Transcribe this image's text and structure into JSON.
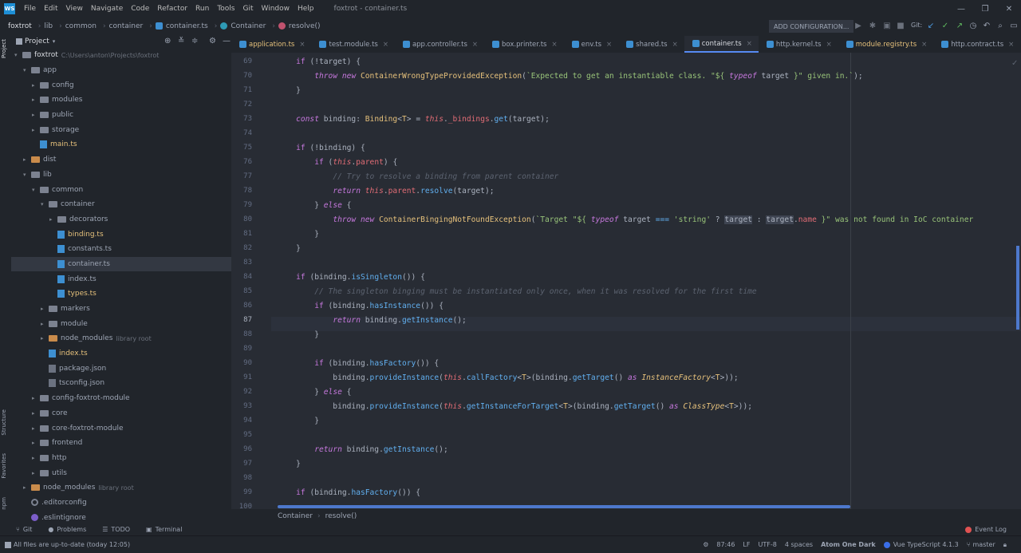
{
  "menu": [
    "File",
    "Edit",
    "View",
    "Navigate",
    "Code",
    "Refactor",
    "Run",
    "Tools",
    "Git",
    "Window",
    "Help"
  ],
  "window_title": "foxtrot - container.ts",
  "nav": {
    "crumbs": [
      "foxtrot",
      "lib",
      "common",
      "container",
      "container.ts",
      "Container",
      "resolve()"
    ],
    "run_config": "ADD CONFIGURATION...",
    "git_label": "Git:"
  },
  "sidebar": {
    "project_label": "Project",
    "structure_label": "Structure",
    "favorites_label": "Favorites",
    "npm_label": "npm"
  },
  "tree": [
    {
      "d": 0,
      "arrow": "▾",
      "icon": "folder",
      "label": "foxtrot",
      "extra": "C:\\Users\\anton\\Projects\\foxtrot"
    },
    {
      "d": 1,
      "arrow": "▾",
      "icon": "folder",
      "label": "app"
    },
    {
      "d": 2,
      "arrow": "▸",
      "icon": "folder",
      "label": "config"
    },
    {
      "d": 2,
      "arrow": "▸",
      "icon": "folder",
      "label": "modules"
    },
    {
      "d": 2,
      "arrow": "▸",
      "icon": "folder",
      "label": "public"
    },
    {
      "d": 2,
      "arrow": "▸",
      "icon": "folder",
      "label": "storage"
    },
    {
      "d": 2,
      "arrow": "",
      "icon": "ts",
      "label": "main.ts"
    },
    {
      "d": 1,
      "arrow": "▸",
      "icon": "folder-orange",
      "label": "dist"
    },
    {
      "d": 1,
      "arrow": "▾",
      "icon": "folder",
      "label": "lib"
    },
    {
      "d": 2,
      "arrow": "▾",
      "icon": "folder",
      "label": "common"
    },
    {
      "d": 3,
      "arrow": "▾",
      "icon": "folder",
      "label": "container"
    },
    {
      "d": 4,
      "arrow": "▸",
      "icon": "folder",
      "label": "decorators"
    },
    {
      "d": 4,
      "arrow": "",
      "icon": "ts",
      "label": "binding.ts"
    },
    {
      "d": 4,
      "arrow": "",
      "icon": "ts",
      "label": "constants.ts"
    },
    {
      "d": 4,
      "arrow": "",
      "icon": "ts",
      "label": "container.ts",
      "selected": true
    },
    {
      "d": 4,
      "arrow": "",
      "icon": "ts",
      "label": "index.ts"
    },
    {
      "d": 4,
      "arrow": "",
      "icon": "ts",
      "label": "types.ts"
    },
    {
      "d": 3,
      "arrow": "▸",
      "icon": "folder",
      "label": "markers"
    },
    {
      "d": 3,
      "arrow": "▸",
      "icon": "folder",
      "label": "module"
    },
    {
      "d": 3,
      "arrow": "▸",
      "icon": "folder-orange",
      "label": "node_modules",
      "extra": "library root"
    },
    {
      "d": 3,
      "arrow": "",
      "icon": "ts",
      "label": "index.ts"
    },
    {
      "d": 3,
      "arrow": "",
      "icon": "json",
      "label": "package.json"
    },
    {
      "d": 3,
      "arrow": "",
      "icon": "json",
      "label": "tsconfig.json"
    },
    {
      "d": 2,
      "arrow": "▸",
      "icon": "folder",
      "label": "config-foxtrot-module"
    },
    {
      "d": 2,
      "arrow": "▸",
      "icon": "folder",
      "label": "core"
    },
    {
      "d": 2,
      "arrow": "▸",
      "icon": "folder",
      "label": "core-foxtrot-module"
    },
    {
      "d": 2,
      "arrow": "▸",
      "icon": "folder",
      "label": "frontend"
    },
    {
      "d": 2,
      "arrow": "▸",
      "icon": "folder",
      "label": "http"
    },
    {
      "d": 2,
      "arrow": "▸",
      "icon": "folder",
      "label": "utils"
    },
    {
      "d": 1,
      "arrow": "▸",
      "icon": "folder-orange",
      "label": "node_modules",
      "extra": "library root"
    },
    {
      "d": 1,
      "arrow": "",
      "icon": "cfg",
      "label": ".editorconfig"
    },
    {
      "d": 1,
      "arrow": "",
      "icon": "es",
      "label": ".eslintignore"
    }
  ],
  "tabs": [
    {
      "label": "application.ts"
    },
    {
      "label": "test.module.ts"
    },
    {
      "label": "app.controller.ts"
    },
    {
      "label": "box.printer.ts"
    },
    {
      "label": "env.ts"
    },
    {
      "label": "shared.ts"
    },
    {
      "label": "container.ts",
      "active": true
    },
    {
      "label": "http.kernel.ts"
    },
    {
      "label": "module.registry.ts"
    },
    {
      "label": "http.contract.ts"
    }
  ],
  "editor": {
    "current_line": 87,
    "lines": [
      {
        "n": 69,
        "h": "    <span class=k>if</span> (!target) {"
      },
      {
        "n": 70,
        "h": "        <span class=ki>throw</span> <span class=ki>new</span> <span class=t>ContainerWrongTypeProvidedException</span>(<span class=s>`Expected to get an instantiable class. \"${</span> <span class=ki>typeof</span> target <span class=s>}\" given in.`</span>);"
      },
      {
        "n": 71,
        "h": "    }"
      },
      {
        "n": 72,
        "h": ""
      },
      {
        "n": 73,
        "h": "    <span class=ki>const</span> binding: <span class=t>Binding</span>&lt;<span class=t>T</span>&gt; = <span class=th>this</span>.<span class=p>_bindings</span>.<span class=f>get</span>(target);"
      },
      {
        "n": 74,
        "h": ""
      },
      {
        "n": 75,
        "h": "    <span class=k>if</span> (!binding) {"
      },
      {
        "n": 76,
        "h": "        <span class=k>if</span> (<span class=th>this</span>.<span class=p>parent</span>) {"
      },
      {
        "n": 77,
        "h": "            <span class=c>// Try to resolve a binding from parent container</span>"
      },
      {
        "n": 78,
        "h": "            <span class=ki>return</span> <span class=th>this</span>.<span class=p>parent</span>.<span class=f>resolve</span>(target);"
      },
      {
        "n": 79,
        "h": "        } <span class=ki>else</span> {"
      },
      {
        "n": 80,
        "h": "            <span class=ki>throw</span> <span class=ki>new</span> <span class=t>ContainerBingingNotFoundException</span>(<span class=s>`Target \"${</span> <span class=ki>typeof</span> target <span class=f>===</span> <span class=s>'string'</span> ? <span class=hl>target</span> : <span class=hl>target</span>.<span class=p>name</span> <span class=s>}\" was not found in IoC container</span>"
      },
      {
        "n": 81,
        "h": "        }"
      },
      {
        "n": 82,
        "h": "    }"
      },
      {
        "n": 83,
        "h": ""
      },
      {
        "n": 84,
        "h": "    <span class=k>if</span> (binding.<span class=f>isSingleton</span>()) {"
      },
      {
        "n": 85,
        "h": "        <span class=c>// The singleton binging must be instantiated only once, when it was resolved for the first time</span>"
      },
      {
        "n": 86,
        "h": "        <span class=k>if</span> (binding.<span class=f>hasInstance</span>()) {"
      },
      {
        "n": 87,
        "h": "            <span class=ki>return</span> binding.<span class=f>getInstance</span>();"
      },
      {
        "n": 88,
        "h": "        }"
      },
      {
        "n": 89,
        "h": ""
      },
      {
        "n": 90,
        "h": "        <span class=k>if</span> (binding.<span class=f>hasFactory</span>()) {"
      },
      {
        "n": 91,
        "h": "            binding.<span class=f>provideInstance</span>(<span class=th>this</span>.<span class=f>callFactory</span>&lt;<span class=t>T</span>&gt;(binding.<span class=f>getTarget</span>() <span class=ki>as</span> <span class=t><i>InstanceFactory</i></span>&lt;<span class=t>T</span>&gt;));"
      },
      {
        "n": 92,
        "h": "        } <span class=ki>else</span> {"
      },
      {
        "n": 93,
        "h": "            binding.<span class=f>provideInstance</span>(<span class=th>this</span>.<span class=f>getInstanceForTarget</span>&lt;<span class=t>T</span>&gt;(binding.<span class=f>getTarget</span>() <span class=ki>as</span> <span class=t><i>ClassType</i></span>&lt;<span class=t>T</span>&gt;));"
      },
      {
        "n": 94,
        "h": "        }"
      },
      {
        "n": 95,
        "h": ""
      },
      {
        "n": 96,
        "h": "        <span class=ki>return</span> binding.<span class=f>getInstance</span>();"
      },
      {
        "n": 97,
        "h": "    }"
      },
      {
        "n": 98,
        "h": ""
      },
      {
        "n": 99,
        "h": "    <span class=k>if</span> (binding.<span class=f>hasFactory</span>()) {"
      },
      {
        "n": 100,
        "h": ""
      }
    ]
  },
  "editor_breadcrumb": {
    "cls": "Container",
    "method": "resolve()"
  },
  "bottom_tools": {
    "git": "Git",
    "problems": "Problems",
    "todo": "TODO",
    "terminal": "Terminal",
    "event_log": "Event Log"
  },
  "status": {
    "message": "All files are up-to-date (today 12:05)",
    "position": "87:46",
    "line_sep": "LF",
    "encoding": "UTF-8",
    "indent": "4 spaces",
    "theme": "Atom One Dark",
    "lang": "Vue TypeScript 4.1.3",
    "branch": "master"
  },
  "colors": {
    "accent": "#568af2",
    "bg_editor": "#282c34",
    "bg_panel": "#21252b"
  }
}
